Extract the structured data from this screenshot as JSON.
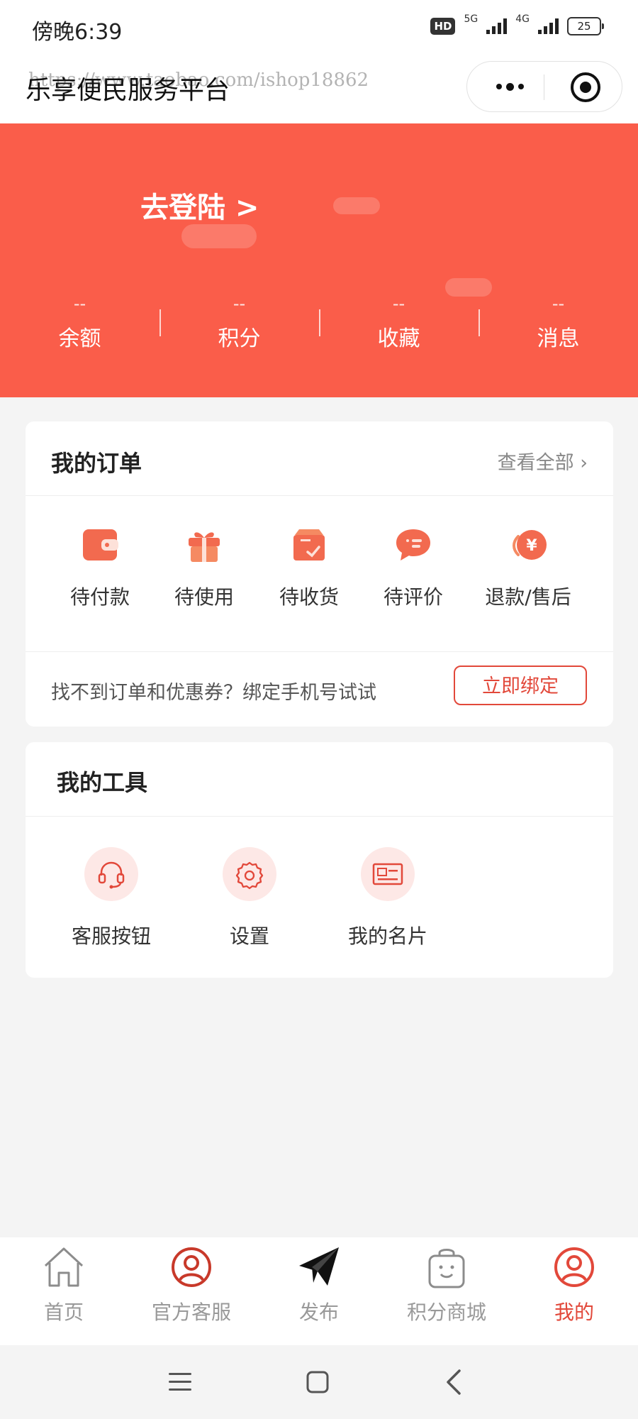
{
  "status_bar": {
    "time": "傍晚6:39",
    "hd_label": "HD",
    "network_1": "5G",
    "network_2": "4G",
    "battery": "25"
  },
  "title_bar": {
    "title": "乐享便民服务平台",
    "watermark": "https://www.taobao.com/ishop18862"
  },
  "header": {
    "login_label": "去登陆 >",
    "stats": [
      {
        "value": "--",
        "label": "余额"
      },
      {
        "value": "--",
        "label": "积分"
      },
      {
        "value": "--",
        "label": "收藏"
      },
      {
        "value": "--",
        "label": "消息"
      }
    ]
  },
  "orders": {
    "title": "我的订单",
    "view_all": "查看全部 ›",
    "items": [
      {
        "label": "待付款",
        "icon": "wallet-icon"
      },
      {
        "label": "待使用",
        "icon": "gift-icon"
      },
      {
        "label": "待收货",
        "icon": "box-icon"
      },
      {
        "label": "待评价",
        "icon": "comment-icon"
      },
      {
        "label": "退款/售后",
        "icon": "refund-icon"
      }
    ],
    "bind_hint": "找不到订单和优惠券？绑定手机号试试",
    "bind_button": "立即绑定"
  },
  "tools": {
    "title": "我的工具",
    "items": [
      {
        "label": "客服按钮",
        "icon": "headset-icon"
      },
      {
        "label": "设置",
        "icon": "gear-icon"
      },
      {
        "label": "我的名片",
        "icon": "card-icon"
      }
    ]
  },
  "tab_bar": {
    "items": [
      {
        "label": "首页",
        "icon": "home-icon"
      },
      {
        "label": "官方客服",
        "icon": "user-circle-icon"
      },
      {
        "label": "发布",
        "icon": "paper-plane-icon"
      },
      {
        "label": "积分商城",
        "icon": "shopping-bag-icon"
      },
      {
        "label": "我的",
        "icon": "user-circle-icon"
      }
    ],
    "active_index": 4
  },
  "colors": {
    "accent": "#e2483a",
    "header_bg": "#fa5d4a",
    "page_bg": "#f4f4f4"
  }
}
